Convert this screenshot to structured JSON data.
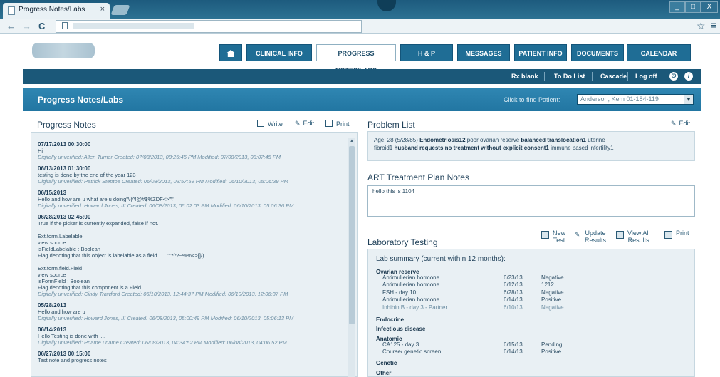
{
  "browser": {
    "tab_title": "Progress Notes/Labs",
    "tab_close": "×",
    "win_min": "_",
    "win_max": "□",
    "win_close": "X"
  },
  "mainnav": {
    "clinical": "CLINICAL INFO",
    "progress": "PROGRESS NOTES/LABS",
    "hp": "H & P",
    "messages": "MESSAGES",
    "patient": "PATIENT INFO",
    "documents": "DOCUMENTS",
    "calendar": "CALENDAR WIZARD"
  },
  "utilbar": {
    "rx": "Rx blank",
    "todo": "To Do List",
    "cascade": "Cascade",
    "logoff": "Log off",
    "power_icon": "⏻",
    "help_icon": "i"
  },
  "titlebar": {
    "title": "Progress Notes/Labs",
    "find_label": "Click to find Patient:",
    "patient_value": "Anderson, Kem  01-184-119"
  },
  "progress_notes": {
    "title": "Progress Notes",
    "write": "Write",
    "edit": "Edit",
    "print": "Print",
    "notes": [
      {
        "date": "07/17/2013 00:30:00",
        "body": "Hi",
        "sig": "Digitally unverified: Allen Turner Created: 07/08/2013, 08:25:45 PM Modified: 07/08/2013, 08:07:45 PM"
      },
      {
        "date": "06/13/2013 01:30:00",
        "body": "testing is done by the end of the year 123",
        "sig": "Digitally unverified: Patrick Steptoe Created: 06/08/2013, 03:57:59 PM Modified: 06/10/2013, 05:06:39 PM"
      },
      {
        "date": "06/15/2013",
        "body": "Hello and how are u what are u doing\"\\'(^!@#$%ZDF<>\"\\\"",
        "sig": "Digitally unverified: Howard Jones, III Created: 06/08/2013, 05:02:03 PM Modified: 06/10/2013, 05:06:36 PM"
      },
      {
        "date": "06/28/2013 02:45:00",
        "body": "True if the picker is currently expanded, false if not.\n\nExt.form.Labelable\nview source\nisFieldLabelable : Boolean\nFlag denoting that this object is labelable as a field. .... ''\"*^?~%%<>[]{(\n\nExt.form.field.Field\nview source\nisFormField : Boolean\nFlag denoting that this component is a Field. ....",
        "sig": "Digitally unverified: Cindy Trawford Created: 06/10/2013, 12:44:37 PM Modified: 06/10/2013, 12:06:37 PM"
      },
      {
        "date": "05/28/2013",
        "body": "Hello and how are u",
        "sig": "Digitally unverified: Howard Jones, III Created: 06/08/2013, 05:00:49 PM Modified: 06/10/2013, 05:06:13 PM"
      },
      {
        "date": "06/14/2013",
        "body": "Hello Testing is done with ....",
        "sig": "Digitally unverified: Pname Lname Created: 06/08/2013, 04:34:52 PM Modified: 06/08/2013, 04:06:52 PM"
      },
      {
        "date": "06/27/2013 00:15:00",
        "body": "Test note and progress notes",
        "sig": ""
      }
    ]
  },
  "problem_list": {
    "title": "Problem List",
    "edit": "Edit",
    "line1_a": "Age: 28 (5/28/85)",
    "line1_b": "Endometriosis12",
    "line1_c": "poor ovarian reserve",
    "line1_d": "balanced translocation1",
    "line1_e": "uterine",
    "line2_a": "fibroid1",
    "line2_b": "husband requests no treatment without explicit consent1",
    "line2_c": "immune based infertility1"
  },
  "art": {
    "title": "ART Treatment Plan Notes",
    "text": "hello this is 1104"
  },
  "lab": {
    "title": "Laboratory Testing",
    "new_test_1": "New",
    "new_test_2": "Test",
    "update_1": "Update",
    "update_2": "Results",
    "viewall_1": "View All",
    "viewall_2": "Results",
    "print": "Print",
    "summary": "Lab summary (current within 12 months):",
    "groups": {
      "ovarian": "Ovarian reserve",
      "endocrine": "Endocrine",
      "infectious": "Infectious disease",
      "anatomic": "Anatomic",
      "genetic": "Genetic",
      "other": "Other"
    },
    "rows": [
      {
        "name": "Antimullerian hormone",
        "date": "6/23/13",
        "result": "Negative"
      },
      {
        "name": "Antimullerian hormone",
        "date": "6/12/13",
        "result": "1212"
      },
      {
        "name": "FSH - day 10",
        "date": "6/28/13",
        "result": "Negative"
      },
      {
        "name": "Antimullerian hormone",
        "date": "6/14/13",
        "result": "Positive"
      },
      {
        "name": "Inhibin B - day 3 - Partner",
        "date": "6/10/13",
        "result": "Negative"
      },
      {
        "name": "CA125 - day 3",
        "date": "6/15/13",
        "result": "Pending"
      },
      {
        "name": "Course/ genetic screen",
        "date": "6/14/13",
        "result": "Positive"
      }
    ]
  }
}
